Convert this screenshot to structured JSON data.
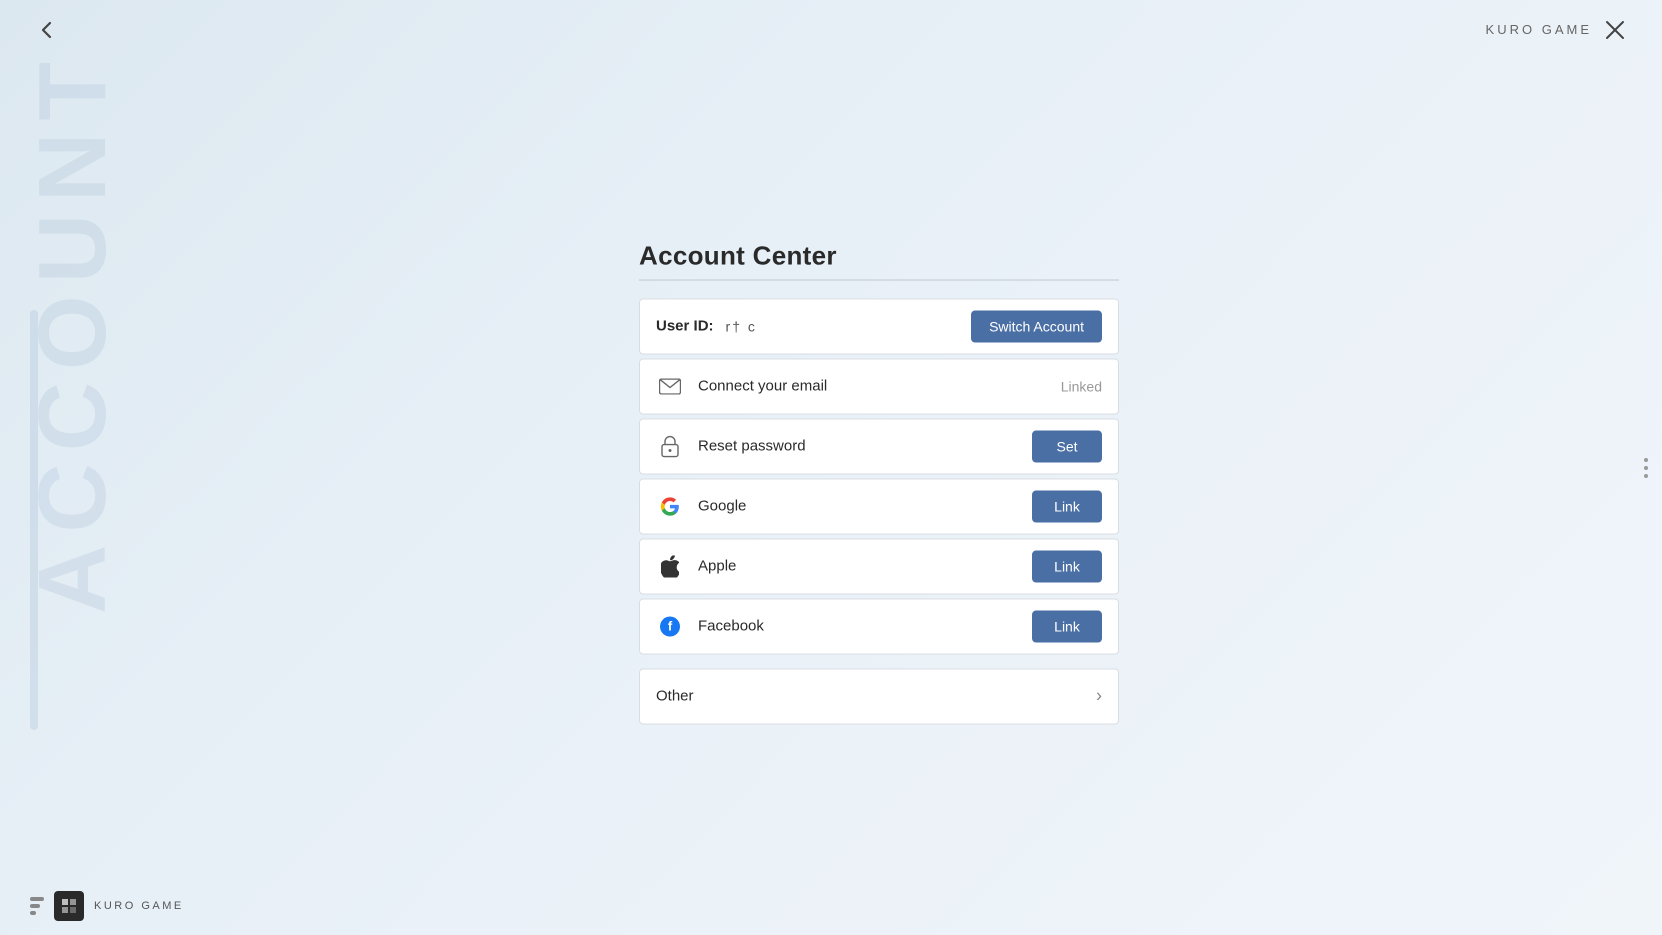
{
  "watermark": "ACCOUNT",
  "topBar": {
    "backLabel": "‹",
    "closeLabel": "✕"
  },
  "topBrand": "KURO GAME",
  "pageTitle": "Account Center",
  "userIdRow": {
    "label": "User ID:",
    "value": "r† c",
    "switchBtn": "Switch Account"
  },
  "rows": [
    {
      "id": "email",
      "icon": "email",
      "label": "Connect your email",
      "actionType": "text",
      "actionText": "Linked"
    },
    {
      "id": "password",
      "icon": "lock",
      "label": "Reset password",
      "actionType": "button",
      "actionText": "Set"
    },
    {
      "id": "google",
      "icon": "google",
      "label": "Google",
      "actionType": "button",
      "actionText": "Link"
    },
    {
      "id": "apple",
      "icon": "apple",
      "label": "Apple",
      "actionType": "button",
      "actionText": "Link"
    },
    {
      "id": "facebook",
      "icon": "facebook",
      "label": "Facebook",
      "actionType": "button",
      "actionText": "Link"
    }
  ],
  "otherRow": {
    "label": "Other",
    "chevron": "›"
  },
  "bottomLogo": {
    "bars": [
      14,
      10,
      6
    ],
    "brandText": "KURO GAME"
  }
}
